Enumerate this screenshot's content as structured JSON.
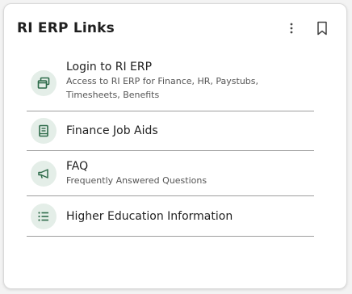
{
  "card": {
    "title": "RI ERP Links",
    "actions": [
      {
        "name": "more",
        "icon": "more-vertical-icon"
      },
      {
        "name": "bookmark",
        "icon": "bookmark-icon"
      }
    ]
  },
  "links": [
    {
      "title": "Login to RI ERP",
      "description_line1": "Access to RI ERP for Finance, HR, Paystubs,",
      "description_line2": "Timesheets, Benefits",
      "icon": "windows-icon"
    },
    {
      "title": "Finance Job Aids",
      "icon": "book-icon"
    },
    {
      "title": "FAQ",
      "description_line1": "Frequently Answered Questions",
      "icon": "megaphone-icon"
    },
    {
      "title": "Higher Education Information",
      "icon": "list-icon"
    }
  ],
  "colors": {
    "icon_green": "#2e6b4a",
    "icon_bg": "#e4eee8",
    "divider": "#9e9e9e"
  }
}
